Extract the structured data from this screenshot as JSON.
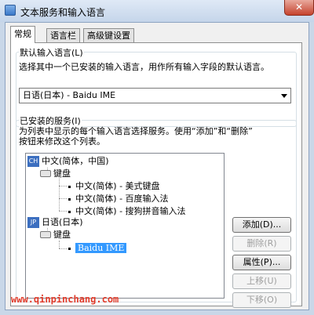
{
  "window": {
    "title": "文本服务和输入语言",
    "close_glyph": "✕"
  },
  "tabs": [
    {
      "label": "常规",
      "active": true
    },
    {
      "label": "语言栏",
      "active": false
    },
    {
      "label": "高级键设置",
      "active": false
    }
  ],
  "default_language": {
    "legend": "默认输入语言(L)",
    "description": "选择其中一个已安装的输入语言，用作所有输入字段的默认语言。",
    "selected": "日语(日本) - Baidu IME"
  },
  "installed_services": {
    "legend": "已安装的服务(I)",
    "description_line1": "为列表中显示的每个输入语言选择服务。使用“添加”和“删除”",
    "description_line2": "按钮来修改这个列表。",
    "tree": {
      "chinese": {
        "badge": "CH",
        "label": "中文(简体，中国)",
        "keyboard_label": "键盘",
        "items": [
          "中文(简体) - 美式键盘",
          "中文(简体) - 百度输入法",
          "中文(简体) - 搜狗拼音输入法"
        ]
      },
      "japanese": {
        "badge": "JP",
        "label": "日语(日本)",
        "keyboard_label": "键盘",
        "items": [
          "Baidu IME"
        ]
      }
    }
  },
  "buttons": {
    "add": "添加(D)...",
    "remove": "删除(R)",
    "properties": "属性(P)...",
    "move_up": "上移(U)",
    "move_down": "下移(O)"
  },
  "watermark": "www.qinpinchang.com"
}
